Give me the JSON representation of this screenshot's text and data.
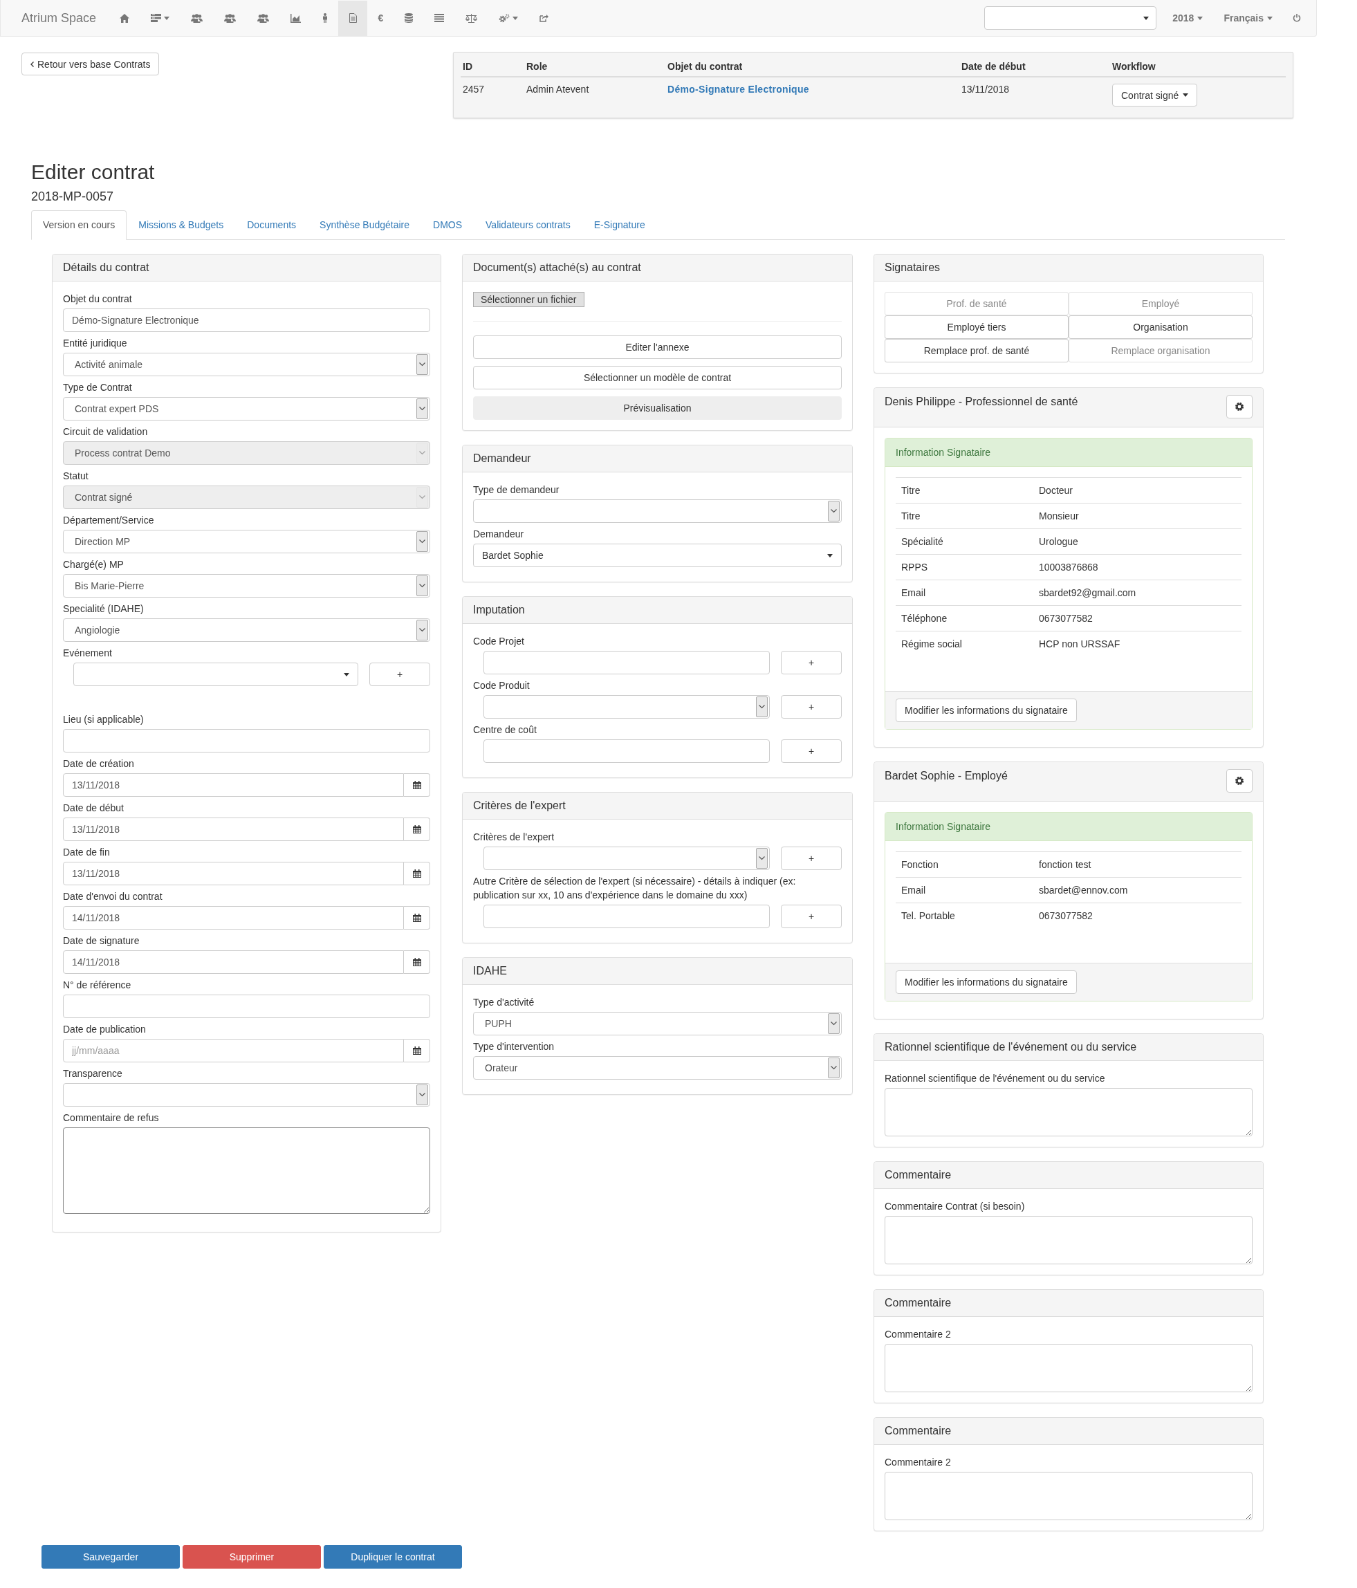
{
  "navbar": {
    "brand": "Atrium Space",
    "items": [
      {
        "kind": "home",
        "selected": false,
        "dropdown": false
      },
      {
        "kind": "list",
        "selected": false,
        "dropdown": true
      },
      {
        "kind": "users",
        "selected": false,
        "dropdown": false
      },
      {
        "kind": "users",
        "selected": false,
        "dropdown": false
      },
      {
        "kind": "users",
        "selected": false,
        "dropdown": false
      },
      {
        "kind": "chart",
        "selected": false,
        "dropdown": false
      },
      {
        "kind": "person",
        "selected": false,
        "dropdown": false
      },
      {
        "kind": "file",
        "selected": true,
        "dropdown": false
      },
      {
        "kind": "text",
        "text": "€",
        "selected": false,
        "dropdown": false
      },
      {
        "kind": "database",
        "selected": false,
        "dropdown": false
      },
      {
        "kind": "lines",
        "selected": false,
        "dropdown": false
      },
      {
        "kind": "scale",
        "selected": false,
        "dropdown": false
      },
      {
        "kind": "cogs",
        "selected": false,
        "dropdown": true
      },
      {
        "kind": "share",
        "selected": false,
        "dropdown": false
      }
    ],
    "year": "2018",
    "language": "Français"
  },
  "back_button": "Retour vers base Contrats",
  "record_table": {
    "columns": [
      "ID",
      "Role",
      "Objet du contrat",
      "Date de début",
      "Workflow"
    ],
    "rows": [
      {
        "cells": [
          {
            "kind": "text",
            "text": "2457"
          },
          {
            "kind": "text",
            "text": "Admin Atevent"
          },
          {
            "kind": "link",
            "text": "Démo-Signature Electronique"
          },
          {
            "kind": "text",
            "text": "13/11/2018"
          },
          {
            "kind": "dropdown",
            "text": "Contrat signé"
          }
        ]
      }
    ]
  },
  "title": "Editer contrat",
  "reference": "2018-MP-0057",
  "tabs": [
    {
      "label": "Version en cours",
      "selected": true
    },
    {
      "label": "Missions & Budgets",
      "selected": false
    },
    {
      "label": "Documents",
      "selected": false
    },
    {
      "label": "Synthèse Budgétaire",
      "selected": false
    },
    {
      "label": "DMOS",
      "selected": false
    },
    {
      "label": "Validateurs contrats",
      "selected": false
    },
    {
      "label": "E-Signature",
      "selected": false
    }
  ],
  "left_panel": {
    "title": "Détails du contrat",
    "fields": [
      {
        "kind": "input",
        "label": "Objet du contrat",
        "value": "Démo-Signature Electronique"
      },
      {
        "kind": "select",
        "label": "Entité juridique",
        "value": "Activité animale",
        "disabled": false
      },
      {
        "kind": "select",
        "label": "Type de Contrat",
        "value": "Contrat expert PDS",
        "disabled": false
      },
      {
        "kind": "select",
        "label": "Circuit de validation",
        "value": "Process contrat Demo",
        "disabled": true
      },
      {
        "kind": "select",
        "label": "Statut",
        "value": "Contrat signé",
        "disabled": true
      },
      {
        "kind": "select",
        "label": "Département/Service",
        "value": "Direction MP",
        "disabled": false
      },
      {
        "kind": "select",
        "label": "Chargé(e) MP",
        "value": "Bis Marie-Pierre",
        "disabled": false
      },
      {
        "kind": "select",
        "label": "Specialité (IDAHE)",
        "value": "Angiologie",
        "disabled": false
      },
      {
        "kind": "combo",
        "label": "Evénement",
        "add_button": "+"
      },
      {
        "kind": "input",
        "label": "Lieu (si applicable)"
      },
      {
        "kind": "date",
        "label": "Date de création",
        "value": "13/11/2018"
      },
      {
        "kind": "date",
        "label": "Date de début",
        "value": "13/11/2018"
      },
      {
        "kind": "date",
        "label": "Date de fin",
        "value": "13/11/2018"
      },
      {
        "kind": "date",
        "label": "Date d'envoi du contrat",
        "value": "14/11/2018"
      },
      {
        "kind": "date",
        "label": "Date de signature",
        "value": "14/11/2018"
      },
      {
        "kind": "input",
        "label": "N° de référence"
      },
      {
        "kind": "date",
        "label": "Date de publication",
        "placeholder": "jj/mm/aaaa"
      },
      {
        "kind": "select",
        "label": "Transparence",
        "disabled": false
      },
      {
        "kind": "textarea",
        "label": "Commentaire de refus"
      }
    ]
  },
  "middle_panels": [
    {
      "kind": "documents",
      "title": "Document(s) attaché(s) au contrat",
      "file_button": "Sélectionner un fichier",
      "buttons": [
        {
          "label": "Editer l'annexe",
          "disabled": false
        },
        {
          "label": "Sélectionner un modèle de contrat",
          "disabled": false
        },
        {
          "label": "Prévisualisation",
          "disabled": true
        }
      ]
    },
    {
      "kind": "form",
      "title": "Demandeur",
      "fields": [
        {
          "kind": "select",
          "label": "Type de demandeur"
        },
        {
          "kind": "combo",
          "label": "Demandeur",
          "value": "Bardet Sophie"
        }
      ]
    },
    {
      "kind": "form",
      "title": "Imputation",
      "fields": [
        {
          "kind": "input",
          "label": "Code Projet",
          "add_button": "+"
        },
        {
          "kind": "select",
          "label": "Code Produit",
          "add_button": "+"
        },
        {
          "kind": "input",
          "label": "Centre de coût",
          "add_button": "+"
        }
      ]
    },
    {
      "kind": "form",
      "title": "Critères de l'expert",
      "fields": [
        {
          "kind": "select",
          "label": "Critères de l'expert",
          "add_button": "+"
        },
        {
          "kind": "input",
          "label": "Autre Critère de sélection de l'expert (si nécessaire) - détails à indiquer (ex: publication sur xx, 10 ans d'expérience dans le domaine du xxx)",
          "add_button": "+"
        }
      ]
    },
    {
      "kind": "form",
      "title": "IDAHE",
      "fields": [
        {
          "kind": "select",
          "label": "Type d'activité",
          "value": "PUPH"
        },
        {
          "kind": "select",
          "label": "Type d'intervention",
          "value": "Orateur"
        }
      ]
    }
  ],
  "right_panels": [
    {
      "kind": "signataires",
      "title": "Signataires",
      "buttons": [
        {
          "label": "Prof. de santé",
          "disabled": true
        },
        {
          "label": "Employé",
          "disabled": true
        },
        {
          "label": "Employé tiers",
          "disabled": false
        },
        {
          "label": "Organisation",
          "disabled": false
        },
        {
          "label": "Remplace prof. de santé",
          "disabled": false
        },
        {
          "label": "Remplace organisation",
          "disabled": true
        }
      ]
    },
    {
      "kind": "signatory",
      "title": "Denis Philippe - Professionnel de santé",
      "info_title": "Information Signataire",
      "rows": [
        {
          "label": "Titre",
          "value": "Docteur"
        },
        {
          "label": "Titre",
          "value": "Monsieur"
        },
        {
          "label": "Spécialité",
          "value": "Urologue"
        },
        {
          "label": "RPPS",
          "value": "10003876868"
        },
        {
          "label": "Email",
          "value": "sbardet92@gmail.com"
        },
        {
          "label": "Téléphone",
          "value": "0673077582"
        },
        {
          "label": "Régime social",
          "value": "HCP non URSSAF"
        }
      ],
      "button": "Modifier les informations du signataire"
    },
    {
      "kind": "signatory",
      "title": "Bardet Sophie - Employé",
      "info_title": "Information Signataire",
      "rows": [
        {
          "label": "Fonction",
          "value": "fonction test"
        },
        {
          "label": "Email",
          "value": "sbardet@ennov.com"
        },
        {
          "label": "Tel. Portable",
          "value": "0673077582"
        }
      ],
      "button": "Modifier les informations du signataire"
    },
    {
      "kind": "comment",
      "title": "Rationnel scientifique de l'événement ou du service",
      "label": "Rationnel scientifique de l'événement ou du service"
    },
    {
      "kind": "comment",
      "title": "Commentaire",
      "label": "Commentaire Contrat (si besoin)"
    },
    {
      "kind": "comment",
      "title": "Commentaire",
      "label": "Commentaire 2"
    },
    {
      "kind": "comment",
      "title": "Commentaire",
      "label": "Commentaire 2"
    }
  ],
  "actions": [
    {
      "kind": "primary",
      "label": "Sauvegarder"
    },
    {
      "kind": "danger",
      "label": "Supprimer"
    },
    {
      "kind": "primary",
      "label": "Dupliquer le contrat"
    }
  ]
}
